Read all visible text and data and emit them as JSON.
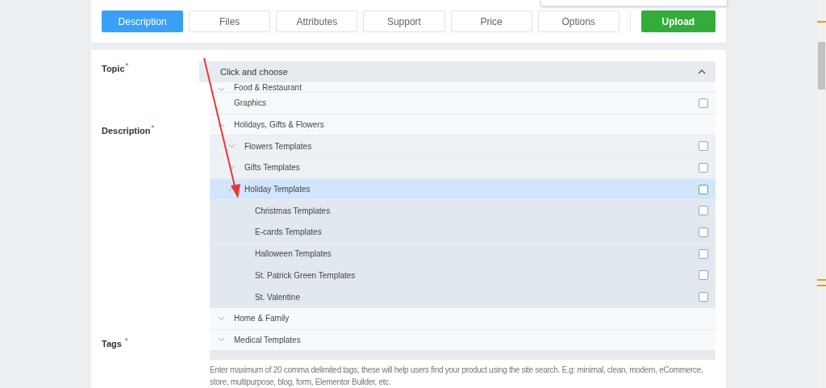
{
  "tabs": [
    {
      "label": "Description",
      "selected": true
    },
    {
      "label": "Files",
      "selected": false
    },
    {
      "label": "Attributes",
      "selected": false
    },
    {
      "label": "Support",
      "selected": false
    },
    {
      "label": "Price",
      "selected": false
    },
    {
      "label": "Options",
      "selected": false
    }
  ],
  "upload_button": {
    "label": "Upload"
  },
  "form": {
    "topic": {
      "label": "Topic",
      "required_mark": "*",
      "dropdown": {
        "placeholder": "Click and choose",
        "expanded": true,
        "items": [
          {
            "label": "Food & Restaurant",
            "expandable": true,
            "expanded": false,
            "checkbox": false,
            "selected": false
          },
          {
            "label": "Graphics",
            "expandable": false,
            "expanded": false,
            "checkbox": true,
            "checked": false,
            "selected": false
          },
          {
            "label": "Holidays, Gifts & Flowers",
            "expandable": true,
            "expanded": true,
            "checkbox": false,
            "selected": false,
            "children": [
              {
                "label": "Flowers Templates",
                "expandable": true,
                "expanded": false,
                "checkbox": true,
                "checked": false,
                "selected": false
              },
              {
                "label": "Gifts Templates",
                "expandable": true,
                "expanded": false,
                "checkbox": true,
                "checked": false,
                "selected": false
              },
              {
                "label": "Holiday Templates",
                "expandable": true,
                "expanded": true,
                "checkbox": true,
                "checked": false,
                "selected": true,
                "children": [
                  {
                    "label": "Christmas Templates",
                    "expandable": false,
                    "expanded": false,
                    "checkbox": true,
                    "checked": false,
                    "selected": false
                  },
                  {
                    "label": "E-cards Templates",
                    "expandable": false,
                    "expanded": false,
                    "checkbox": true,
                    "checked": false,
                    "selected": false
                  },
                  {
                    "label": "Halloween Templates",
                    "expandable": false,
                    "expanded": false,
                    "checkbox": true,
                    "checked": false,
                    "selected": false
                  },
                  {
                    "label": "St. Patrick Green Templates",
                    "expandable": false,
                    "expanded": false,
                    "checkbox": true,
                    "checked": false,
                    "selected": false
                  },
                  {
                    "label": "St. Valentine",
                    "expandable": false,
                    "expanded": false,
                    "checkbox": true,
                    "checked": false,
                    "selected": false
                  }
                ]
              }
            ]
          },
          {
            "label": "Home & Family",
            "expandable": true,
            "expanded": false,
            "checkbox": false,
            "selected": false
          },
          {
            "label": "Medical Templates",
            "expandable": true,
            "expanded": false,
            "checkbox": false,
            "selected": false
          }
        ]
      }
    },
    "description": {
      "label": "Description",
      "required_mark": "*"
    },
    "tags": {
      "label": "Tags",
      "required_mark": "*",
      "help": "Enter maximum of 20 comma delimited tags, these will help users find your product using the site search. E.g: minimal, clean, modern, eCommerce, store, multipurpose, blog, form, Elementor Builder, etc."
    }
  }
}
